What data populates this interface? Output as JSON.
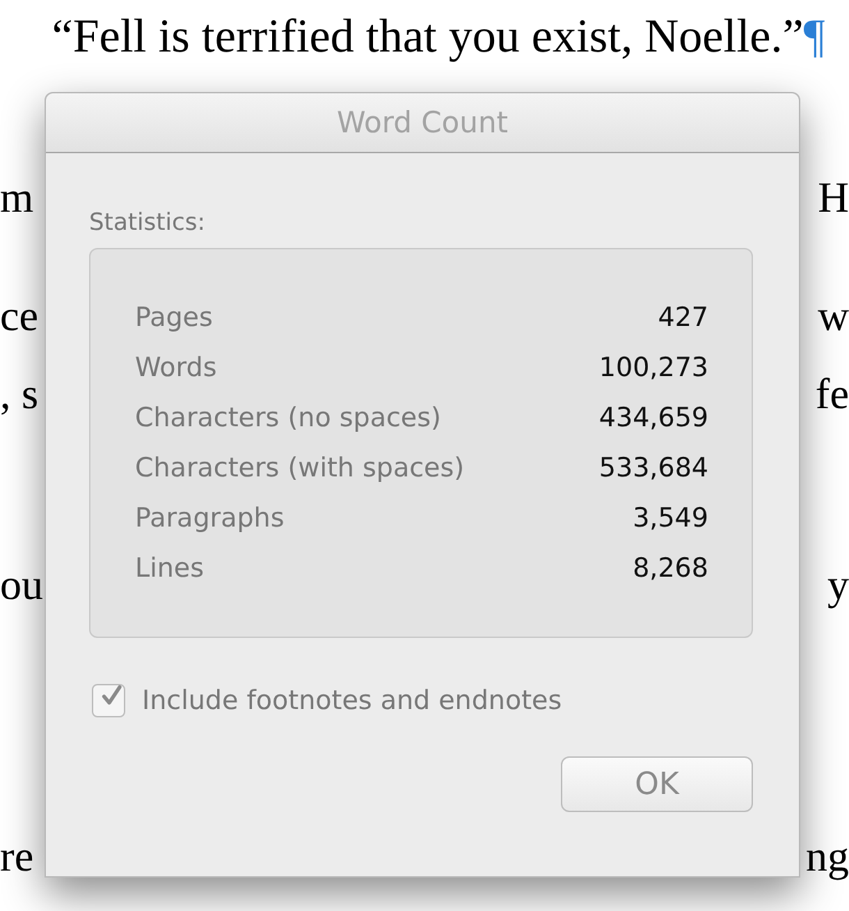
{
  "document": {
    "heading": {
      "text": "“Fell is terrified that you exist, Noelle.”",
      "mark": "¶"
    },
    "lines": [
      {
        "left": "m",
        "right": "H"
      },
      {
        "left": "ce",
        "right": "w"
      },
      {
        "left": ", s",
        "right": "fe"
      },
      {
        "left": "ou",
        "right": "y"
      },
      {
        "left": "re",
        "right": "ng"
      }
    ]
  },
  "dialog": {
    "title": "Word Count",
    "section_label": "Statistics:",
    "stats": [
      {
        "label": "Pages",
        "value": "427"
      },
      {
        "label": "Words",
        "value": "100,273"
      },
      {
        "label": "Characters (no spaces)",
        "value": "434,659"
      },
      {
        "label": "Characters (with spaces)",
        "value": "533,684"
      },
      {
        "label": "Paragraphs",
        "value": "3,549"
      },
      {
        "label": "Lines",
        "value": "8,268"
      }
    ],
    "checkbox": {
      "label": "Include footnotes and endnotes",
      "checked": true
    },
    "buttons": [
      "OK"
    ]
  }
}
